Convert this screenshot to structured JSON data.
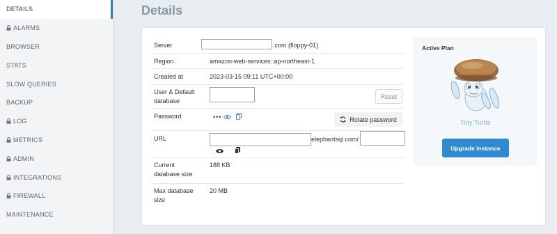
{
  "sidebar": {
    "items": [
      {
        "label": "DETAILS",
        "locked": false,
        "active": true
      },
      {
        "label": "ALARMS",
        "locked": true,
        "active": false
      },
      {
        "label": "BROWSER",
        "locked": false,
        "active": false
      },
      {
        "label": "STATS",
        "locked": false,
        "active": false
      },
      {
        "label": "SLOW QUERIES",
        "locked": false,
        "active": false
      },
      {
        "label": "BACKUP",
        "locked": false,
        "active": false
      },
      {
        "label": "LOG",
        "locked": true,
        "active": false
      },
      {
        "label": "METRICS",
        "locked": true,
        "active": false
      },
      {
        "label": "ADMIN",
        "locked": true,
        "active": false
      },
      {
        "label": "INTEGRATIONS",
        "locked": true,
        "active": false
      },
      {
        "label": "FIREWALL",
        "locked": true,
        "active": false
      },
      {
        "label": "MAINTENANCE",
        "locked": false,
        "active": false
      }
    ]
  },
  "page": {
    "title": "Details"
  },
  "details": {
    "server": {
      "label": "Server",
      "value_suffix": ".com (floppy-01)"
    },
    "region": {
      "label": "Region",
      "value": "amazon-web-services::ap-northeast-1"
    },
    "created": {
      "label": "Created at",
      "value": "2023-03-15 09:11 UTC+00:00"
    },
    "user_db": {
      "label_line1": "User & Default",
      "label_line2": "database",
      "reset_label": "Reset"
    },
    "password": {
      "label": "Password",
      "masked": "•••",
      "rotate_label": "Rotate password"
    },
    "url": {
      "label": "URL",
      "middle_text": "elephantsql.com/"
    },
    "current_size": {
      "label_line1": "Current",
      "label_line2": "database size",
      "value": "188 KB"
    },
    "max_size": {
      "label_line1": "Max database",
      "label_line2": "size",
      "value": "20 MB"
    }
  },
  "plan": {
    "heading": "Active Plan",
    "name": "Tiny Turtle",
    "upgrade_label": "Upgrade instance"
  },
  "colors": {
    "accent": "#2f8ad0",
    "plan_name": "#7eb3db",
    "title": "#8b96a1"
  }
}
